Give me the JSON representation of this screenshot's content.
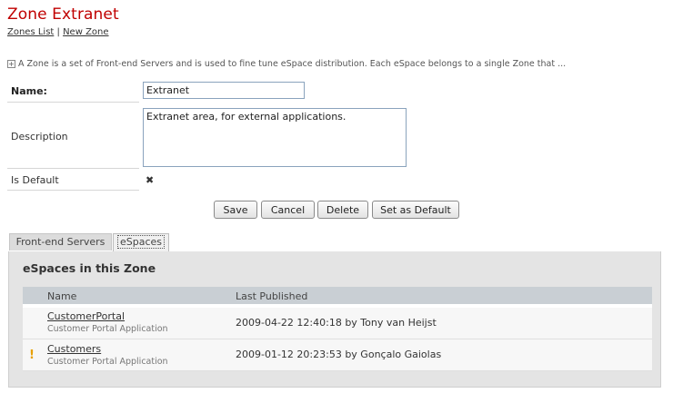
{
  "header": {
    "title": "Zone Extranet",
    "breadcrumb": {
      "zones_list": "Zones List",
      "separator": "|",
      "new_zone": "New Zone"
    }
  },
  "intro": {
    "expand_symbol": "+",
    "text": "A Zone is a set of Front-end Servers and is used to fine tune eSpace distribution. Each eSpace belongs to a single Zone that ..."
  },
  "form": {
    "name_label": "Name:",
    "name_value": "Extranet",
    "description_label": "Description",
    "description_value": "Extranet area, for external applications.",
    "is_default_label": "Is Default",
    "is_default_mark": "✖"
  },
  "buttons": {
    "save": "Save",
    "cancel": "Cancel",
    "delete": "Delete",
    "set_default": "Set as Default"
  },
  "tabs": [
    {
      "label": "Front-end Servers",
      "active": false
    },
    {
      "label": "eSpaces",
      "active": true
    }
  ],
  "espaces": {
    "title": "eSpaces in this Zone",
    "columns": [
      "Name",
      "Last Published"
    ],
    "rows": [
      {
        "name": "CustomerPortal",
        "subtitle": "Customer Portal Application",
        "last_published": "2009-04-22 12:40:18 by Tony van Heijst",
        "warning": ""
      },
      {
        "name": "Customers",
        "subtitle": "Customer Portal Application",
        "last_published": "2009-01-12 20:23:53 by Gonçalo Gaiolas",
        "warning": "!"
      }
    ]
  },
  "colors": {
    "title": "#c00000",
    "warning": "#e8a000",
    "table_header": "#c9cfd4"
  }
}
